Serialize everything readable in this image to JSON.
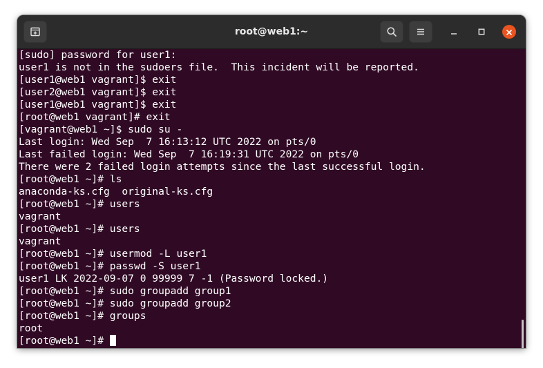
{
  "window": {
    "title": "root@web1:~"
  },
  "toolbar": {
    "new_tab_icon": "new-tab-icon",
    "search_icon": "search-icon",
    "menu_icon": "hamburger-menu-icon",
    "minimize_icon": "minimize-icon",
    "maximize_icon": "maximize-icon",
    "close_icon": "close-icon"
  },
  "colors": {
    "terminal_background": "#300a24",
    "terminal_text": "#ffffff",
    "titlebar": "#2c2c2c",
    "close_button": "#e95420"
  },
  "terminal": {
    "lines": [
      "[sudo] password for user1:",
      "user1 is not in the sudoers file.  This incident will be reported.",
      "[user1@web1 vagrant]$ exit",
      "[user2@web1 vagrant]$ exit",
      "[user1@web1 vagrant]$ exit",
      "[root@web1 vagrant]# exit",
      "[vagrant@web1 ~]$ sudo su -",
      "Last login: Wed Sep  7 16:13:12 UTC 2022 on pts/0",
      "Last failed login: Wed Sep  7 16:19:31 UTC 2022 on pts/0",
      "There were 2 failed login attempts since the last successful login.",
      "[root@web1 ~]# ls",
      "anaconda-ks.cfg  original-ks.cfg",
      "[root@web1 ~]# users",
      "vagrant",
      "[root@web1 ~]# users",
      "vagrant",
      "[root@web1 ~]# usermod -L user1",
      "[root@web1 ~]# passwd -S user1",
      "user1 LK 2022-09-07 0 99999 7 -1 (Password locked.)",
      "[root@web1 ~]# sudo groupadd group1",
      "[root@web1 ~]# sudo groupadd group2",
      "[root@web1 ~]# groups",
      "root"
    ],
    "prompt": "[root@web1 ~]# "
  }
}
